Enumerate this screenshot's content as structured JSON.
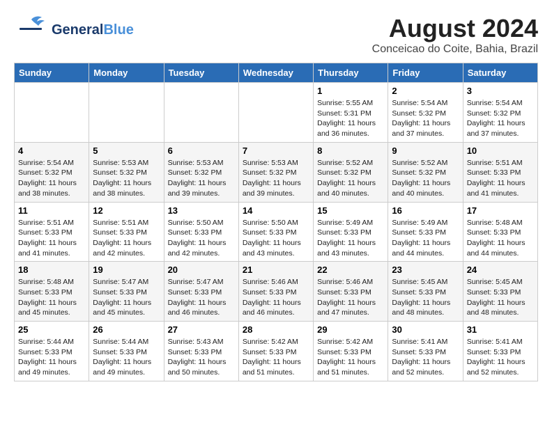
{
  "header": {
    "logo_general": "General",
    "logo_blue": "Blue",
    "month_title": "August 2024",
    "location": "Conceicao do Coite, Bahia, Brazil"
  },
  "weekdays": [
    "Sunday",
    "Monday",
    "Tuesday",
    "Wednesday",
    "Thursday",
    "Friday",
    "Saturday"
  ],
  "weeks": [
    [
      {
        "day": "",
        "info": ""
      },
      {
        "day": "",
        "info": ""
      },
      {
        "day": "",
        "info": ""
      },
      {
        "day": "",
        "info": ""
      },
      {
        "day": "1",
        "sunrise": "5:55 AM",
        "sunset": "5:31 PM",
        "daylight": "11 hours and 36 minutes."
      },
      {
        "day": "2",
        "sunrise": "5:54 AM",
        "sunset": "5:32 PM",
        "daylight": "11 hours and 37 minutes."
      },
      {
        "day": "3",
        "sunrise": "5:54 AM",
        "sunset": "5:32 PM",
        "daylight": "11 hours and 37 minutes."
      }
    ],
    [
      {
        "day": "4",
        "sunrise": "5:54 AM",
        "sunset": "5:32 PM",
        "daylight": "11 hours and 38 minutes."
      },
      {
        "day": "5",
        "sunrise": "5:53 AM",
        "sunset": "5:32 PM",
        "daylight": "11 hours and 38 minutes."
      },
      {
        "day": "6",
        "sunrise": "5:53 AM",
        "sunset": "5:32 PM",
        "daylight": "11 hours and 39 minutes."
      },
      {
        "day": "7",
        "sunrise": "5:53 AM",
        "sunset": "5:32 PM",
        "daylight": "11 hours and 39 minutes."
      },
      {
        "day": "8",
        "sunrise": "5:52 AM",
        "sunset": "5:32 PM",
        "daylight": "11 hours and 40 minutes."
      },
      {
        "day": "9",
        "sunrise": "5:52 AM",
        "sunset": "5:32 PM",
        "daylight": "11 hours and 40 minutes."
      },
      {
        "day": "10",
        "sunrise": "5:51 AM",
        "sunset": "5:33 PM",
        "daylight": "11 hours and 41 minutes."
      }
    ],
    [
      {
        "day": "11",
        "sunrise": "5:51 AM",
        "sunset": "5:33 PM",
        "daylight": "11 hours and 41 minutes."
      },
      {
        "day": "12",
        "sunrise": "5:51 AM",
        "sunset": "5:33 PM",
        "daylight": "11 hours and 42 minutes."
      },
      {
        "day": "13",
        "sunrise": "5:50 AM",
        "sunset": "5:33 PM",
        "daylight": "11 hours and 42 minutes."
      },
      {
        "day": "14",
        "sunrise": "5:50 AM",
        "sunset": "5:33 PM",
        "daylight": "11 hours and 43 minutes."
      },
      {
        "day": "15",
        "sunrise": "5:49 AM",
        "sunset": "5:33 PM",
        "daylight": "11 hours and 43 minutes."
      },
      {
        "day": "16",
        "sunrise": "5:49 AM",
        "sunset": "5:33 PM",
        "daylight": "11 hours and 44 minutes."
      },
      {
        "day": "17",
        "sunrise": "5:48 AM",
        "sunset": "5:33 PM",
        "daylight": "11 hours and 44 minutes."
      }
    ],
    [
      {
        "day": "18",
        "sunrise": "5:48 AM",
        "sunset": "5:33 PM",
        "daylight": "11 hours and 45 minutes."
      },
      {
        "day": "19",
        "sunrise": "5:47 AM",
        "sunset": "5:33 PM",
        "daylight": "11 hours and 45 minutes."
      },
      {
        "day": "20",
        "sunrise": "5:47 AM",
        "sunset": "5:33 PM",
        "daylight": "11 hours and 46 minutes."
      },
      {
        "day": "21",
        "sunrise": "5:46 AM",
        "sunset": "5:33 PM",
        "daylight": "11 hours and 46 minutes."
      },
      {
        "day": "22",
        "sunrise": "5:46 AM",
        "sunset": "5:33 PM",
        "daylight": "11 hours and 47 minutes."
      },
      {
        "day": "23",
        "sunrise": "5:45 AM",
        "sunset": "5:33 PM",
        "daylight": "11 hours and 48 minutes."
      },
      {
        "day": "24",
        "sunrise": "5:45 AM",
        "sunset": "5:33 PM",
        "daylight": "11 hours and 48 minutes."
      }
    ],
    [
      {
        "day": "25",
        "sunrise": "5:44 AM",
        "sunset": "5:33 PM",
        "daylight": "11 hours and 49 minutes."
      },
      {
        "day": "26",
        "sunrise": "5:44 AM",
        "sunset": "5:33 PM",
        "daylight": "11 hours and 49 minutes."
      },
      {
        "day": "27",
        "sunrise": "5:43 AM",
        "sunset": "5:33 PM",
        "daylight": "11 hours and 50 minutes."
      },
      {
        "day": "28",
        "sunrise": "5:42 AM",
        "sunset": "5:33 PM",
        "daylight": "11 hours and 51 minutes."
      },
      {
        "day": "29",
        "sunrise": "5:42 AM",
        "sunset": "5:33 PM",
        "daylight": "11 hours and 51 minutes."
      },
      {
        "day": "30",
        "sunrise": "5:41 AM",
        "sunset": "5:33 PM",
        "daylight": "11 hours and 52 minutes."
      },
      {
        "day": "31",
        "sunrise": "5:41 AM",
        "sunset": "5:33 PM",
        "daylight": "11 hours and 52 minutes."
      }
    ]
  ],
  "labels": {
    "sunrise": "Sunrise:",
    "sunset": "Sunset:",
    "daylight": "Daylight:"
  }
}
